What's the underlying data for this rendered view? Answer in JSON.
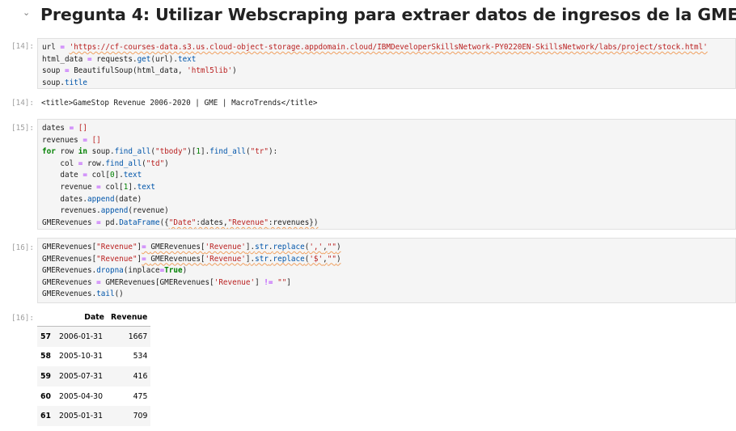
{
  "heading": {
    "caret": "⌄",
    "title": "Pregunta 4: Utilizar Webscraping para extraer datos de ingresos de la GME"
  },
  "cells": [
    {
      "prompt": "[14]:",
      "code": [
        [
          [
            "url ",
            "plain"
          ],
          [
            "= ",
            "op"
          ],
          [
            "'https://cf-courses-data.s3.us.cloud-object-storage.appdomain.cloud/IBMDeveloperSkillsNetwork-PY0220EN-SkillsNetwork/labs/project/stock.html'",
            "str"
          ]
        ],
        [
          [
            "html_data ",
            "plain"
          ],
          [
            "= ",
            "op"
          ],
          [
            "requests",
            "plain"
          ],
          [
            ".",
            "plain"
          ],
          [
            "get",
            "fn"
          ],
          [
            "(url)",
            "plain"
          ],
          [
            ".",
            "plain"
          ],
          [
            "text",
            "fn"
          ]
        ],
        [
          [
            "soup ",
            "plain"
          ],
          [
            "= ",
            "op"
          ],
          [
            "BeautifulSoup(html_data, ",
            "plain"
          ],
          [
            "'html5lib'",
            "str"
          ],
          [
            ")",
            "plain"
          ]
        ],
        [
          [
            "soup",
            "plain"
          ],
          [
            ".",
            "plain"
          ],
          [
            "title",
            "fn"
          ]
        ]
      ]
    },
    {
      "prompt": "[14]:",
      "output": "<title>GameStop Revenue 2006-2020 | GME | MacroTrends</title>"
    },
    {
      "prompt": "[15]:",
      "code": [
        [
          [
            "dates ",
            "plain"
          ],
          [
            "= ",
            "op"
          ],
          [
            "[]",
            "str"
          ]
        ],
        [
          [
            "revenues ",
            "plain"
          ],
          [
            "= ",
            "op"
          ],
          [
            "[]",
            "str"
          ]
        ],
        [
          [
            "for",
            "kw"
          ],
          [
            " row ",
            "plain"
          ],
          [
            "in",
            "kw"
          ],
          [
            " soup",
            "plain"
          ],
          [
            ".",
            "plain"
          ],
          [
            "find_all",
            "fn"
          ],
          [
            "(",
            "plain"
          ],
          [
            "\"tbody\"",
            "str"
          ],
          [
            ")[",
            "plain"
          ],
          [
            "1",
            "num"
          ],
          [
            "]",
            "plain"
          ],
          [
            ".",
            "plain"
          ],
          [
            "find_all",
            "fn"
          ],
          [
            "(",
            "plain"
          ],
          [
            "\"tr\"",
            "str"
          ],
          [
            "):",
            "plain"
          ]
        ],
        [
          [
            "    col ",
            "plain"
          ],
          [
            "= ",
            "op"
          ],
          [
            "row",
            "plain"
          ],
          [
            ".",
            "plain"
          ],
          [
            "find_all",
            "fn"
          ],
          [
            "(",
            "plain"
          ],
          [
            "\"td\"",
            "str"
          ],
          [
            ")",
            "plain"
          ]
        ],
        [
          [
            "    date ",
            "plain"
          ],
          [
            "= ",
            "op"
          ],
          [
            "col[",
            "plain"
          ],
          [
            "0",
            "num"
          ],
          [
            "]",
            "plain"
          ],
          [
            ".",
            "plain"
          ],
          [
            "text",
            "fn"
          ]
        ],
        [
          [
            "    revenue ",
            "plain"
          ],
          [
            "= ",
            "op"
          ],
          [
            "col[",
            "plain"
          ],
          [
            "1",
            "num"
          ],
          [
            "]",
            "plain"
          ],
          [
            ".",
            "plain"
          ],
          [
            "text",
            "fn"
          ]
        ],
        [
          [
            "    dates",
            "plain"
          ],
          [
            ".",
            "plain"
          ],
          [
            "append",
            "fn"
          ],
          [
            "(date)",
            "plain"
          ]
        ],
        [
          [
            "    revenues",
            "plain"
          ],
          [
            ".",
            "plain"
          ],
          [
            "append",
            "fn"
          ],
          [
            "(revenue)",
            "plain"
          ]
        ],
        [
          [
            "GMERevenues ",
            "plain"
          ],
          [
            "= ",
            "op"
          ],
          [
            "pd",
            "plain"
          ],
          [
            ".",
            "plain"
          ],
          [
            "DataFrame",
            "fn"
          ],
          [
            "({",
            "plain"
          ],
          [
            "\"Date\"",
            "str"
          ],
          [
            ":dates,",
            "plain"
          ],
          [
            "\"Revenue\"",
            "str"
          ],
          [
            ":revenues})",
            "plain"
          ]
        ]
      ]
    },
    {
      "prompt": "[16]:",
      "code": [
        [
          [
            "GMERevenues[",
            "plain"
          ],
          [
            "\"Revenue\"",
            "str"
          ],
          [
            "]",
            "plain"
          ],
          [
            "= ",
            "op"
          ],
          [
            "GMERevenues[",
            "plain"
          ],
          [
            "'Revenue'",
            "str"
          ],
          [
            "]",
            "plain"
          ],
          [
            ".",
            "plain"
          ],
          [
            "str",
            "fn"
          ],
          [
            ".",
            "plain"
          ],
          [
            "replace",
            "fn"
          ],
          [
            "(",
            "plain"
          ],
          [
            "','",
            "str"
          ],
          [
            ",",
            "plain"
          ],
          [
            "\"\"",
            "str"
          ],
          [
            ")",
            "plain"
          ]
        ],
        [
          [
            "GMERevenues[",
            "plain"
          ],
          [
            "\"Revenue\"",
            "str"
          ],
          [
            "]",
            "plain"
          ],
          [
            "= ",
            "op"
          ],
          [
            "GMERevenues[",
            "plain"
          ],
          [
            "'Revenue'",
            "str"
          ],
          [
            "]",
            "plain"
          ],
          [
            ".",
            "plain"
          ],
          [
            "str",
            "fn"
          ],
          [
            ".",
            "plain"
          ],
          [
            "replace",
            "fn"
          ],
          [
            "(",
            "plain"
          ],
          [
            "'$'",
            "str"
          ],
          [
            ",",
            "plain"
          ],
          [
            "\"\"",
            "str"
          ],
          [
            ")",
            "plain"
          ]
        ],
        [
          [
            "GMERevenues",
            "plain"
          ],
          [
            ".",
            "plain"
          ],
          [
            "dropna",
            "fn"
          ],
          [
            "(inplace",
            "plain"
          ],
          [
            "=",
            "op"
          ],
          [
            "True",
            "kw"
          ],
          [
            ")",
            "plain"
          ]
        ],
        [
          [
            "GMERevenues ",
            "plain"
          ],
          [
            "= ",
            "op"
          ],
          [
            "GMERevenues[GMERevenues[",
            "plain"
          ],
          [
            "'Revenue'",
            "str"
          ],
          [
            "] ",
            "plain"
          ],
          [
            "!= ",
            "op"
          ],
          [
            "\"\"",
            "str"
          ],
          [
            "]",
            "plain"
          ]
        ],
        [
          [
            "GMERevenues",
            "plain"
          ],
          [
            ".",
            "plain"
          ],
          [
            "tail",
            "fn"
          ],
          [
            "()",
            "plain"
          ]
        ]
      ]
    },
    {
      "prompt": "[16]:",
      "table": {
        "columns": [
          "Date",
          "Revenue"
        ],
        "rows": [
          {
            "index": "57",
            "date": "2006-01-31",
            "revenue": "1667"
          },
          {
            "index": "58",
            "date": "2005-10-31",
            "revenue": "534"
          },
          {
            "index": "59",
            "date": "2005-07-31",
            "revenue": "416"
          },
          {
            "index": "60",
            "date": "2005-04-30",
            "revenue": "475"
          },
          {
            "index": "61",
            "date": "2005-01-31",
            "revenue": "709"
          }
        ]
      }
    }
  ],
  "colors": {
    "string": "#ba2121",
    "keyword": "#008000",
    "function": "#0055aa",
    "operator": "#aa22ff",
    "cell_background": "#f5f5f5",
    "prompt": "#9e9e9e"
  }
}
